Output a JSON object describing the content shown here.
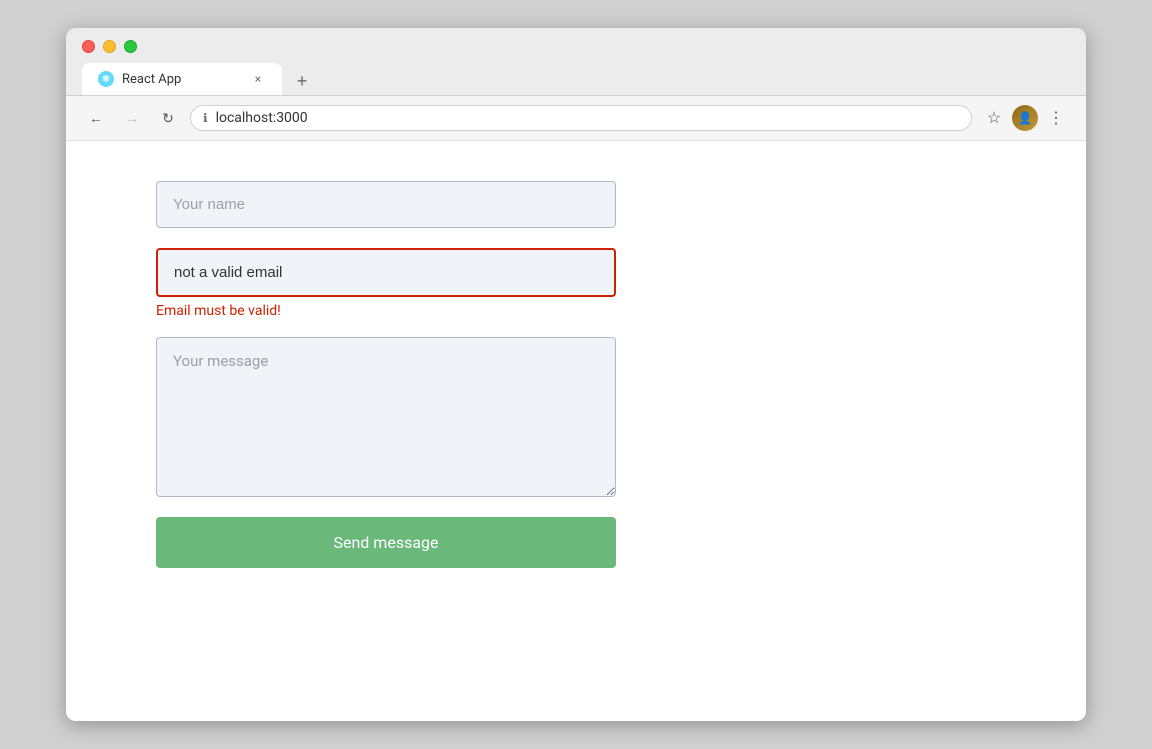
{
  "browser": {
    "traffic_lights": {
      "close_label": "close",
      "minimize_label": "minimize",
      "maximize_label": "maximize"
    },
    "tab": {
      "label": "React App",
      "icon_text": "⚛",
      "close_symbol": "×"
    },
    "new_tab_symbol": "+",
    "nav": {
      "back_symbol": "←",
      "forward_symbol": "→",
      "reload_symbol": "↻",
      "address_icon": "ℹ",
      "url": "localhost:3000",
      "bookmark_symbol": "☆",
      "more_symbol": "⋮"
    }
  },
  "form": {
    "name_placeholder": "Your name",
    "email_value": "not a valid email",
    "email_error": "Email must be valid!",
    "message_placeholder": "Your message",
    "submit_label": "Send message"
  }
}
